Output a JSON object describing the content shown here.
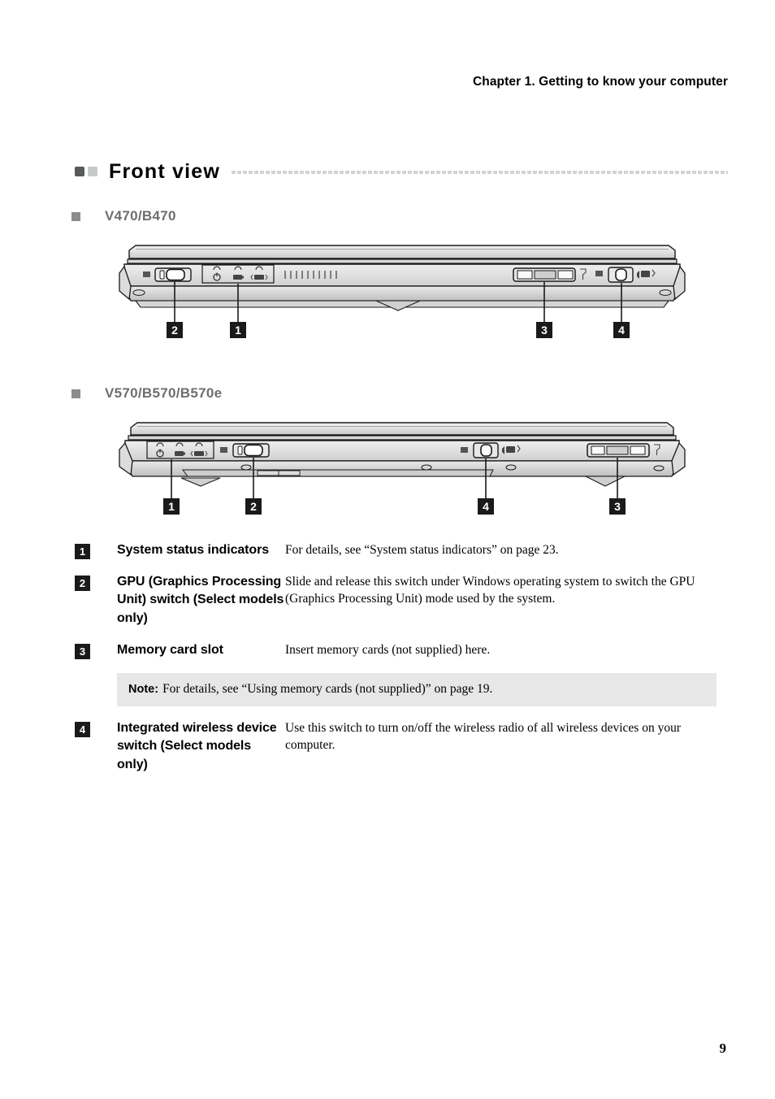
{
  "header": {
    "chapter": "Chapter 1. Getting to know your computer"
  },
  "section": {
    "title": "Front view",
    "marker_dark_color": "#58595b",
    "marker_light_color": "#c7c8ca",
    "rule_color": "#d2d3d4"
  },
  "models": [
    {
      "name": "V470/B470",
      "bullet_color": "#8a8c8e",
      "text_color": "#6d6e71"
    },
    {
      "name": "V570/B570/B570e",
      "bullet_color": "#8a8c8e",
      "text_color": "#6d6e71"
    }
  ],
  "figures": [
    {
      "id": "v470",
      "model": "V470/B470",
      "callouts": [
        {
          "number": "2",
          "target": "gpu-switch"
        },
        {
          "number": "1",
          "target": "system-status-indicators"
        },
        {
          "number": "3",
          "target": "memory-card-slot"
        },
        {
          "number": "4",
          "target": "wireless-device-switch"
        }
      ]
    },
    {
      "id": "v570",
      "model": "V570/B570/B570e",
      "callouts": [
        {
          "number": "1",
          "target": "system-status-indicators"
        },
        {
          "number": "2",
          "target": "gpu-switch"
        },
        {
          "number": "4",
          "target": "wireless-device-switch"
        },
        {
          "number": "3",
          "target": "memory-card-slot"
        }
      ]
    }
  ],
  "items": [
    {
      "number": "1",
      "label": "System status indicators",
      "description": "For details, see “System status indicators” on page 23."
    },
    {
      "number": "2",
      "label": "GPU (Graphics Processing Unit) switch (Select models only)",
      "description": "Slide and release this switch under Windows operating system to switch the GPU (Graphics Processing Unit) mode used by the system."
    },
    {
      "number": "3",
      "label": "Memory card slot",
      "description": "Insert memory cards (not supplied) here."
    },
    {
      "number": "4",
      "label": "Integrated wireless device switch (Select models only)",
      "description": "Use this switch to turn on/off the wireless radio of all wireless devices on your computer."
    }
  ],
  "note": {
    "keyword": "Note:",
    "text": "For details, see “Using memory cards (not supplied)” on page 19.",
    "background": "#e7e7e8"
  },
  "footer": {
    "page_number": "9"
  }
}
